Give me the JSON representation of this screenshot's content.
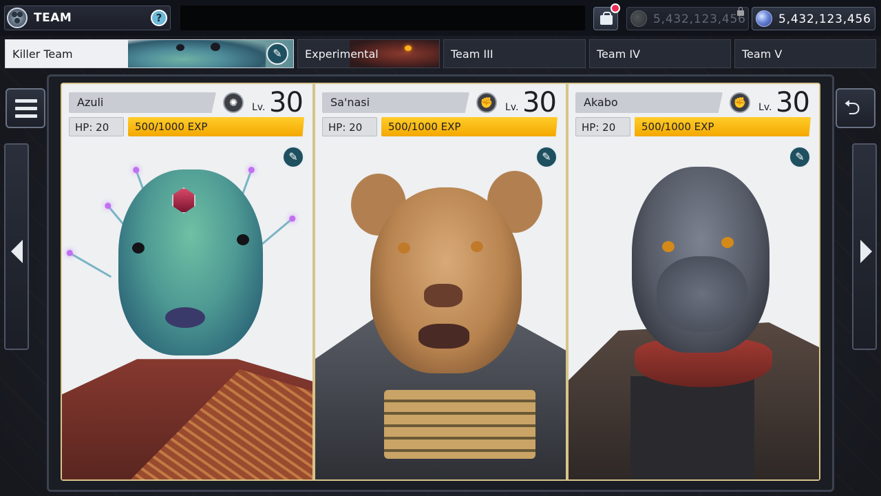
{
  "header": {
    "title": "TEAM",
    "help_label": "?",
    "currency_locked": "5,432,123,456",
    "currency_gems": "5,432,123,456"
  },
  "tabs": [
    {
      "label": "Killer Team",
      "active": true
    },
    {
      "label": "Experimental",
      "active": false
    },
    {
      "label": "Team III",
      "active": false
    },
    {
      "label": "Team IV",
      "active": false
    },
    {
      "label": "Team V",
      "active": false
    }
  ],
  "level_prefix": "Lv.",
  "cards": [
    {
      "name": "Azuli",
      "level": "30",
      "hp": "HP: 20",
      "exp": "500/1000 EXP",
      "class_icon": "shield-emblem-icon"
    },
    {
      "name": "Sa'nasi",
      "level": "30",
      "hp": "HP: 20",
      "exp": "500/1000 EXP",
      "class_icon": "fist-icon"
    },
    {
      "name": "Akabo",
      "level": "30",
      "hp": "HP: 20",
      "exp": "500/1000 EXP",
      "class_icon": "fist-icon"
    }
  ],
  "colors": {
    "accent_exp": "#f4b000",
    "edit_icon": "#1e5060",
    "card_border": "#d8c48a",
    "notification": "#ee2b55"
  }
}
